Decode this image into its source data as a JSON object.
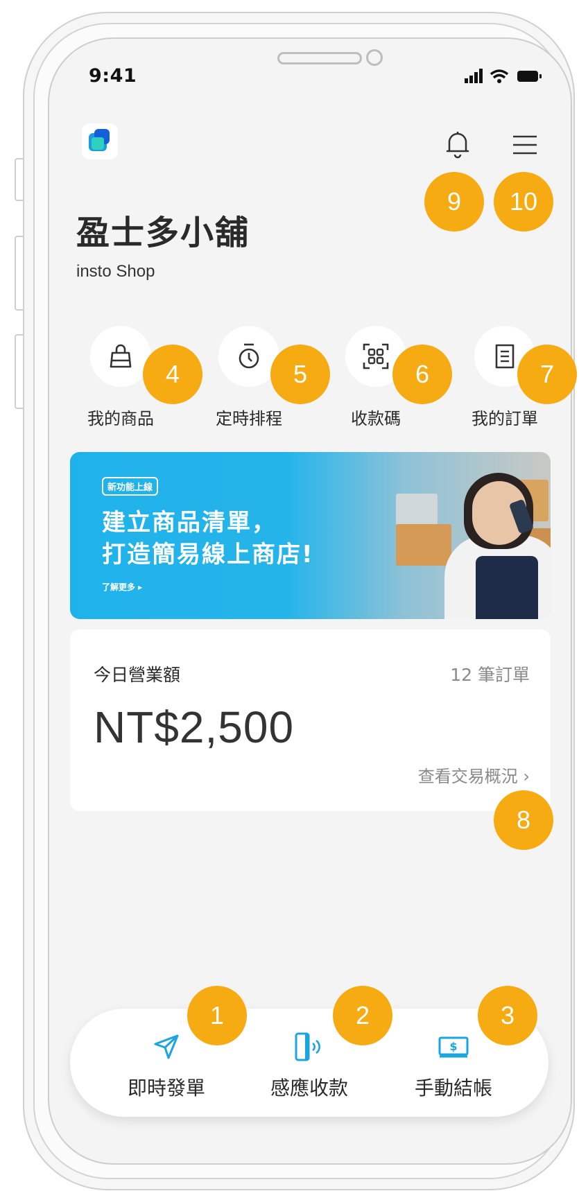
{
  "status_bar": {
    "time": "9:41"
  },
  "header": {
    "shop_name": "盈士多小舖",
    "shop_subtitle": "insto Shop"
  },
  "quick_actions": [
    {
      "label": "我的商品",
      "icon": "shopping-bag-icon"
    },
    {
      "label": "定時排程",
      "icon": "timer-icon"
    },
    {
      "label": "收款碼",
      "icon": "qr-scan-icon"
    },
    {
      "label": "我的訂單",
      "icon": "receipt-icon"
    }
  ],
  "banner": {
    "tag": "新功能上線",
    "line1": "建立商品清單，",
    "line2": "打造簡易線上商店!",
    "more": "了解更多 ▸"
  },
  "sales_card": {
    "label": "今日營業額",
    "orders": "12 筆訂單",
    "amount": "NT$2,500",
    "link": "查看交易概況 ›"
  },
  "bottom_actions": [
    {
      "label": "即時發單",
      "icon": "send-icon"
    },
    {
      "label": "感應收款",
      "icon": "nfc-phone-icon"
    },
    {
      "label": "手動結帳",
      "icon": "cash-icon"
    }
  ],
  "badges": [
    "1",
    "2",
    "3",
    "4",
    "5",
    "6",
    "7",
    "8",
    "9",
    "10"
  ],
  "colors": {
    "badge": "#f6ab12",
    "accent": "#1aa4e0",
    "banner": "#1fb2ea"
  }
}
